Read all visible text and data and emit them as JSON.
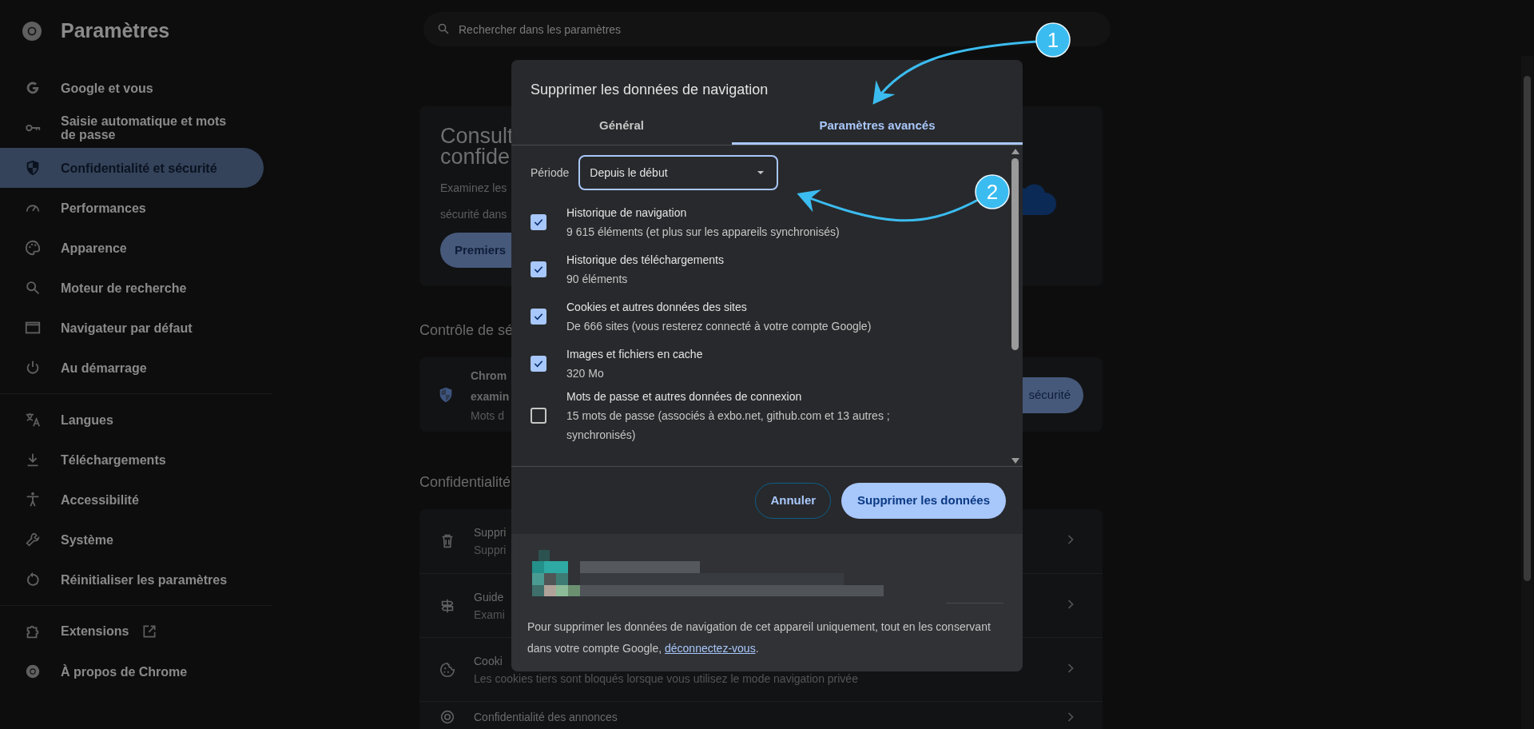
{
  "header": {
    "title": "Paramètres",
    "search_placeholder": "Rechercher dans les paramètres"
  },
  "sidebar": {
    "groups": [
      [
        {
          "label": "Google et vous",
          "selected": false
        },
        {
          "label": "Saisie automatique et mots de passe",
          "selected": false
        },
        {
          "label": "Confidentialité et sécurité",
          "selected": true
        },
        {
          "label": "Performances",
          "selected": false
        },
        {
          "label": "Apparence",
          "selected": false
        },
        {
          "label": "Moteur de recherche",
          "selected": false
        },
        {
          "label": "Navigateur par défaut",
          "selected": false
        },
        {
          "label": "Au démarrage",
          "selected": false
        }
      ],
      [
        {
          "label": "Langues",
          "selected": false
        },
        {
          "label": "Téléchargements",
          "selected": false
        },
        {
          "label": "Accessibilité",
          "selected": false
        },
        {
          "label": "Système",
          "selected": false
        },
        {
          "label": "Réinitialiser les paramètres",
          "selected": false
        }
      ],
      [
        {
          "label": "Extensions",
          "selected": false
        },
        {
          "label": "À propos de Chrome",
          "selected": false
        }
      ]
    ]
  },
  "intro_card": {
    "title_lines": [
      "Consult",
      "confide"
    ],
    "text_lines": [
      "Examinez les",
      "sécurité dans"
    ],
    "button": "Premiers"
  },
  "safety_check": {
    "heading": "Contrôle de sé",
    "title_lines": [
      "Chrom",
      "examin"
    ],
    "subtitle": "Mots d",
    "button": "sécurité"
  },
  "privacy": {
    "heading": "Confidentialité",
    "rows": [
      {
        "title": "Suppri",
        "subtitle": "Suppri"
      },
      {
        "title": "Guide",
        "subtitle": "Exami"
      },
      {
        "title": "Cooki",
        "subtitle": "Les cookies tiers sont bloqués lorsque vous utilisez le mode navigation privée"
      },
      {
        "title": "Confidentialité des annonces"
      }
    ]
  },
  "dialog": {
    "title": "Supprimer les données de navigation",
    "tabs": [
      {
        "label": "Général",
        "selected": false
      },
      {
        "label": "Paramètres avancés",
        "selected": true
      }
    ],
    "period": {
      "label": "Période",
      "value": "Depuis le début"
    },
    "items": [
      {
        "title": "Historique de navigation",
        "detail": "9 615 éléments (et plus sur les appareils synchronisés)",
        "checked": true
      },
      {
        "title": "Historique des téléchargements",
        "detail": "90 éléments",
        "checked": true
      },
      {
        "title": "Cookies et autres données des sites",
        "detail": "De 666 sites (vous resterez connecté à votre compte Google)",
        "checked": true
      },
      {
        "title": "Images et fichiers en cache",
        "detail": "320 Mo",
        "checked": true
      },
      {
        "title": "Mots de passe et autres données de connexion",
        "detail": "15 mots de passe (associés à exbo.net, github.com et 13 autres ; synchronisés)",
        "checked": false
      }
    ],
    "buttons": {
      "cancel": "Annuler",
      "confirm": "Supprimer les données"
    },
    "footer_text": "Pour supprimer les données de navigation de cet appareil uniquement, tout en les conservant dans votre compte Google,",
    "footer_link": "déconnectez-vous",
    "footer_end": "."
  },
  "annotations": [
    {
      "label": "1"
    },
    {
      "label": "2"
    }
  ]
}
